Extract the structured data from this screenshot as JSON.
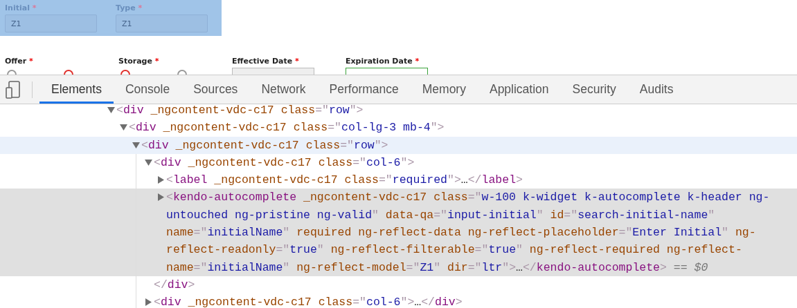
{
  "form": {
    "rows": [
      {
        "inspect_highlight": true,
        "fields": [
          {
            "label": "Initial",
            "required_mark": "*",
            "control": {
              "kind": "text",
              "value": "Z1",
              "readonly": true
            }
          },
          {
            "label": "Type",
            "required_mark": "*",
            "control": {
              "kind": "text",
              "value": "Z1",
              "readonly": true
            }
          }
        ]
      },
      {
        "inspect_highlight": false,
        "fields": [
          {
            "label": "Offer",
            "required_mark": "*",
            "control": {
              "kind": "radios",
              "options": [
                {
                  "color": "#999999"
                },
                {
                  "color": "#e0302b"
                }
              ]
            }
          },
          {
            "label": "Storage",
            "required_mark": "*",
            "control": {
              "kind": "radios",
              "options": [
                {
                  "color": "#e0302b"
                },
                {
                  "color": "#999999"
                }
              ]
            }
          },
          {
            "label": "Effective Date",
            "required_mark": "*",
            "control": {
              "kind": "date",
              "focused": false
            }
          },
          {
            "label": "Expiration Date",
            "required_mark": "*",
            "control": {
              "kind": "date",
              "focused": true
            }
          }
        ]
      }
    ]
  },
  "devtools": {
    "tabs": [
      {
        "label": "Elements",
        "selected": true
      },
      {
        "label": "Console",
        "selected": false
      },
      {
        "label": "Sources",
        "selected": false
      },
      {
        "label": "Network",
        "selected": false
      },
      {
        "label": "Performance",
        "selected": false
      },
      {
        "label": "Memory",
        "selected": false
      },
      {
        "label": "Application",
        "selected": false
      },
      {
        "label": "Security",
        "selected": false
      },
      {
        "label": "Audits",
        "selected": false
      }
    ],
    "dom_tree": [
      {
        "kind": "element",
        "expanded": true,
        "hovered": false,
        "selected": false,
        "tokens": [
          {
            "kind": "punct",
            "text": "<"
          },
          {
            "kind": "tag",
            "text": "div"
          },
          {
            "kind": "attr_name",
            "text": " _ngcontent-vdc-c17 class"
          },
          {
            "kind": "punct",
            "text": "=\""
          },
          {
            "kind": "attr_value",
            "text": "row"
          },
          {
            "kind": "punct",
            "text": "\">"
          }
        ],
        "children": [
          {
            "kind": "element",
            "expanded": true,
            "hovered": false,
            "selected": false,
            "tokens": [
              {
                "kind": "punct",
                "text": "<"
              },
              {
                "kind": "tag",
                "text": "div"
              },
              {
                "kind": "attr_name",
                "text": " _ngcontent-vdc-c17 class"
              },
              {
                "kind": "punct",
                "text": "=\""
              },
              {
                "kind": "attr_value",
                "text": "col-lg-3 mb-4"
              },
              {
                "kind": "punct",
                "text": "\">"
              }
            ],
            "children": [
              {
                "kind": "element",
                "expanded": true,
                "hovered": true,
                "selected": false,
                "tokens": [
                  {
                    "kind": "punct",
                    "text": "<"
                  },
                  {
                    "kind": "tag",
                    "text": "div"
                  },
                  {
                    "kind": "attr_name",
                    "text": " _ngcontent-vdc-c17 class"
                  },
                  {
                    "kind": "punct",
                    "text": "=\""
                  },
                  {
                    "kind": "attr_value",
                    "text": "row"
                  },
                  {
                    "kind": "punct",
                    "text": "\">"
                  }
                ],
                "children": [
                  {
                    "kind": "element",
                    "expanded": true,
                    "hovered": false,
                    "selected": false,
                    "tokens": [
                      {
                        "kind": "punct",
                        "text": "<"
                      },
                      {
                        "kind": "tag",
                        "text": "div"
                      },
                      {
                        "kind": "attr_name",
                        "text": " _ngcontent-vdc-c17 class"
                      },
                      {
                        "kind": "punct",
                        "text": "=\""
                      },
                      {
                        "kind": "attr_value",
                        "text": "col-6"
                      },
                      {
                        "kind": "punct",
                        "text": "\">"
                      }
                    ],
                    "children": [
                      {
                        "kind": "element",
                        "expanded": false,
                        "hovered": false,
                        "selected": false,
                        "tokens": [
                          {
                            "kind": "punct",
                            "text": "<"
                          },
                          {
                            "kind": "tag",
                            "text": "label"
                          },
                          {
                            "kind": "attr_name",
                            "text": " _ngcontent-vdc-c17 class"
                          },
                          {
                            "kind": "punct",
                            "text": "=\""
                          },
                          {
                            "kind": "attr_value",
                            "text": "required"
                          },
                          {
                            "kind": "punct",
                            "text": "\">"
                          },
                          {
                            "kind": "text",
                            "text": "…"
                          },
                          {
                            "kind": "punct",
                            "text": "</"
                          },
                          {
                            "kind": "tag",
                            "text": "label"
                          },
                          {
                            "kind": "punct",
                            "text": ">"
                          }
                        ]
                      },
                      {
                        "kind": "element",
                        "expanded": false,
                        "hovered": false,
                        "selected": true,
                        "tokens": [
                          {
                            "kind": "punct",
                            "text": "<"
                          },
                          {
                            "kind": "tag",
                            "text": "kendo-autocomplete"
                          },
                          {
                            "kind": "attr_name",
                            "text": " _ngcontent-vdc-c17 class"
                          },
                          {
                            "kind": "punct",
                            "text": "=\""
                          },
                          {
                            "kind": "attr_value",
                            "text": "w-100 k-widget k-autocomplete k-header ng-untouched ng-pristine ng-valid"
                          },
                          {
                            "kind": "punct",
                            "text": "\""
                          },
                          {
                            "kind": "attr_name",
                            "text": " data-qa"
                          },
                          {
                            "kind": "punct",
                            "text": "=\""
                          },
                          {
                            "kind": "attr_value",
                            "text": "input-initial"
                          },
                          {
                            "kind": "punct",
                            "text": "\""
                          },
                          {
                            "kind": "attr_name",
                            "text": " id"
                          },
                          {
                            "kind": "punct",
                            "text": "=\""
                          },
                          {
                            "kind": "attr_value",
                            "text": "search-initial-name"
                          },
                          {
                            "kind": "punct",
                            "text": "\""
                          },
                          {
                            "kind": "attr_name",
                            "text": " name"
                          },
                          {
                            "kind": "punct",
                            "text": "=\""
                          },
                          {
                            "kind": "attr_value",
                            "text": "initialName"
                          },
                          {
                            "kind": "punct",
                            "text": "\""
                          },
                          {
                            "kind": "attr_name",
                            "text": " required ng-reflect-data ng-reflect-placeholder"
                          },
                          {
                            "kind": "punct",
                            "text": "=\""
                          },
                          {
                            "kind": "attr_value",
                            "text": "Enter Initial"
                          },
                          {
                            "kind": "punct",
                            "text": "\""
                          },
                          {
                            "kind": "attr_name",
                            "text": " ng-reflect-readonly"
                          },
                          {
                            "kind": "punct",
                            "text": "=\""
                          },
                          {
                            "kind": "attr_value",
                            "text": "true"
                          },
                          {
                            "kind": "punct",
                            "text": "\""
                          },
                          {
                            "kind": "attr_name",
                            "text": " ng-reflect-filterable"
                          },
                          {
                            "kind": "punct",
                            "text": "=\""
                          },
                          {
                            "kind": "attr_value",
                            "text": "true"
                          },
                          {
                            "kind": "punct",
                            "text": "\""
                          },
                          {
                            "kind": "attr_name",
                            "text": " ng-reflect-required ng-reflect-name"
                          },
                          {
                            "kind": "punct",
                            "text": "=\""
                          },
                          {
                            "kind": "attr_value",
                            "text": "initialName"
                          },
                          {
                            "kind": "punct",
                            "text": "\""
                          },
                          {
                            "kind": "attr_name",
                            "text": " ng-reflect-model"
                          },
                          {
                            "kind": "punct",
                            "text": "=\""
                          },
                          {
                            "kind": "attr_value",
                            "text": "Z1"
                          },
                          {
                            "kind": "punct",
                            "text": "\""
                          },
                          {
                            "kind": "attr_name",
                            "text": " dir"
                          },
                          {
                            "kind": "punct",
                            "text": "=\""
                          },
                          {
                            "kind": "attr_value",
                            "text": "ltr"
                          },
                          {
                            "kind": "punct",
                            "text": "\">"
                          },
                          {
                            "kind": "text",
                            "text": "…"
                          },
                          {
                            "kind": "punct",
                            "text": "</"
                          },
                          {
                            "kind": "tag",
                            "text": "kendo-autocomplete"
                          },
                          {
                            "kind": "punct",
                            "text": ">"
                          },
                          {
                            "kind": "console_ref",
                            "text": " == $0"
                          }
                        ]
                      }
                    ]
                  },
                  {
                    "kind": "closing",
                    "tokens": [
                      {
                        "kind": "punct",
                        "text": "</"
                      },
                      {
                        "kind": "tag",
                        "text": "div"
                      },
                      {
                        "kind": "punct",
                        "text": ">"
                      }
                    ]
                  },
                  {
                    "kind": "element",
                    "expanded": false,
                    "hovered": false,
                    "selected": false,
                    "tokens": [
                      {
                        "kind": "punct",
                        "text": "<"
                      },
                      {
                        "kind": "tag",
                        "text": "div"
                      },
                      {
                        "kind": "attr_name",
                        "text": " _ngcontent-vdc-c17 class"
                      },
                      {
                        "kind": "punct",
                        "text": "=\""
                      },
                      {
                        "kind": "attr_value",
                        "text": "col-6"
                      },
                      {
                        "kind": "punct",
                        "text": "\">"
                      },
                      {
                        "kind": "text",
                        "text": "…"
                      },
                      {
                        "kind": "punct",
                        "text": "</"
                      },
                      {
                        "kind": "tag",
                        "text": "div"
                      },
                      {
                        "kind": "punct",
                        "text": ">"
                      }
                    ]
                  }
                ]
              }
            ]
          }
        ]
      }
    ]
  }
}
